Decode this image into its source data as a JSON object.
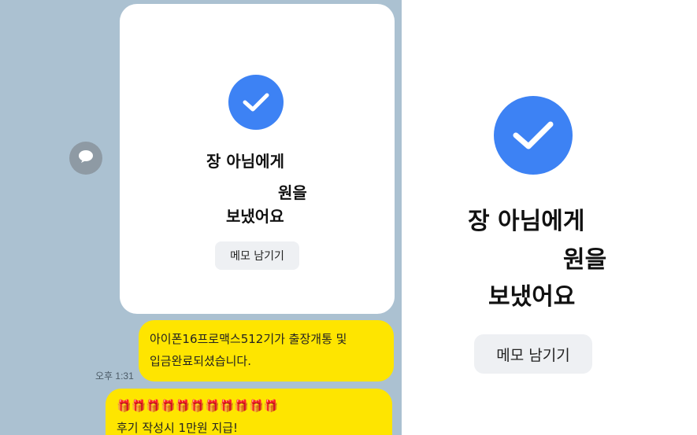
{
  "transfer_card": {
    "recipient_line": "장  아님에게",
    "amount_suffix": "원을",
    "sent_text": "보냈어요",
    "memo_button": "메모 남기기"
  },
  "messages": [
    {
      "text_line1": "아이폰16프로맥스512기가 출장개통 및",
      "text_line2": "입금완료되셨습니다.",
      "time": "오후 1:31"
    },
    {
      "emojis": "🎁🎁🎁🎁🎁🎁🎁🎁🎁🎁🎁",
      "text": "후기 작성시 1만원 지급!"
    }
  ],
  "icons": {
    "share": "speech-bubble-icon",
    "check": "check-circle-icon"
  },
  "colors": {
    "chat_bg": "#abc1d1",
    "bubble": "#fee500",
    "check": "#3d82f4"
  }
}
